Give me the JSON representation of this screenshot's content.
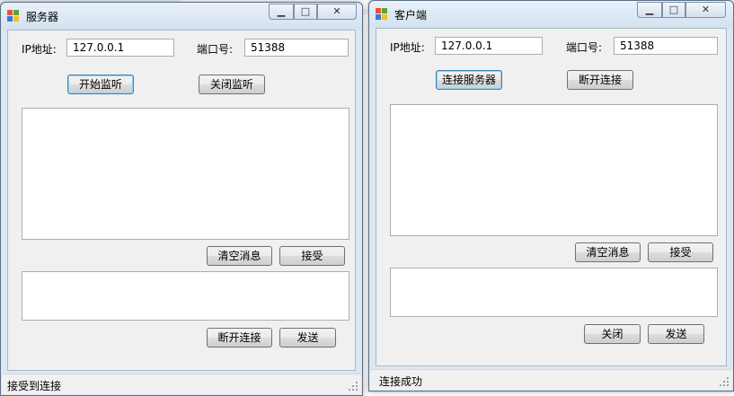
{
  "server": {
    "title": "服务器",
    "ip_label": "IP地址:",
    "ip_value": "127.0.0.1",
    "port_label": "端口号:",
    "port_value": "51388",
    "start_listen": "开始监听",
    "stop_listen": "关闭监听",
    "clear_messages": "清空消息",
    "accept": "接受",
    "disconnect": "断开连接",
    "send": "发送",
    "status": "接受到连接"
  },
  "client": {
    "title": "客户端",
    "ip_label": "IP地址:",
    "ip_value": "127.0.0.1",
    "port_label": "端口号:",
    "port_value": "51388",
    "connect_server": "连接服务器",
    "disconnect": "断开连接",
    "clear_messages": "清空消息",
    "accept": "接受",
    "close": "关闭",
    "send": "发送",
    "status": "连接成功"
  },
  "window_controls": {
    "minimize_icon": "minimize-icon",
    "maximize_icon": "maximize-icon",
    "close_icon": "close-icon"
  },
  "colors": {
    "titlebar": "#dce7f2",
    "client_bg": "#f0f0f0",
    "focus_border": "#3c7fb1"
  }
}
